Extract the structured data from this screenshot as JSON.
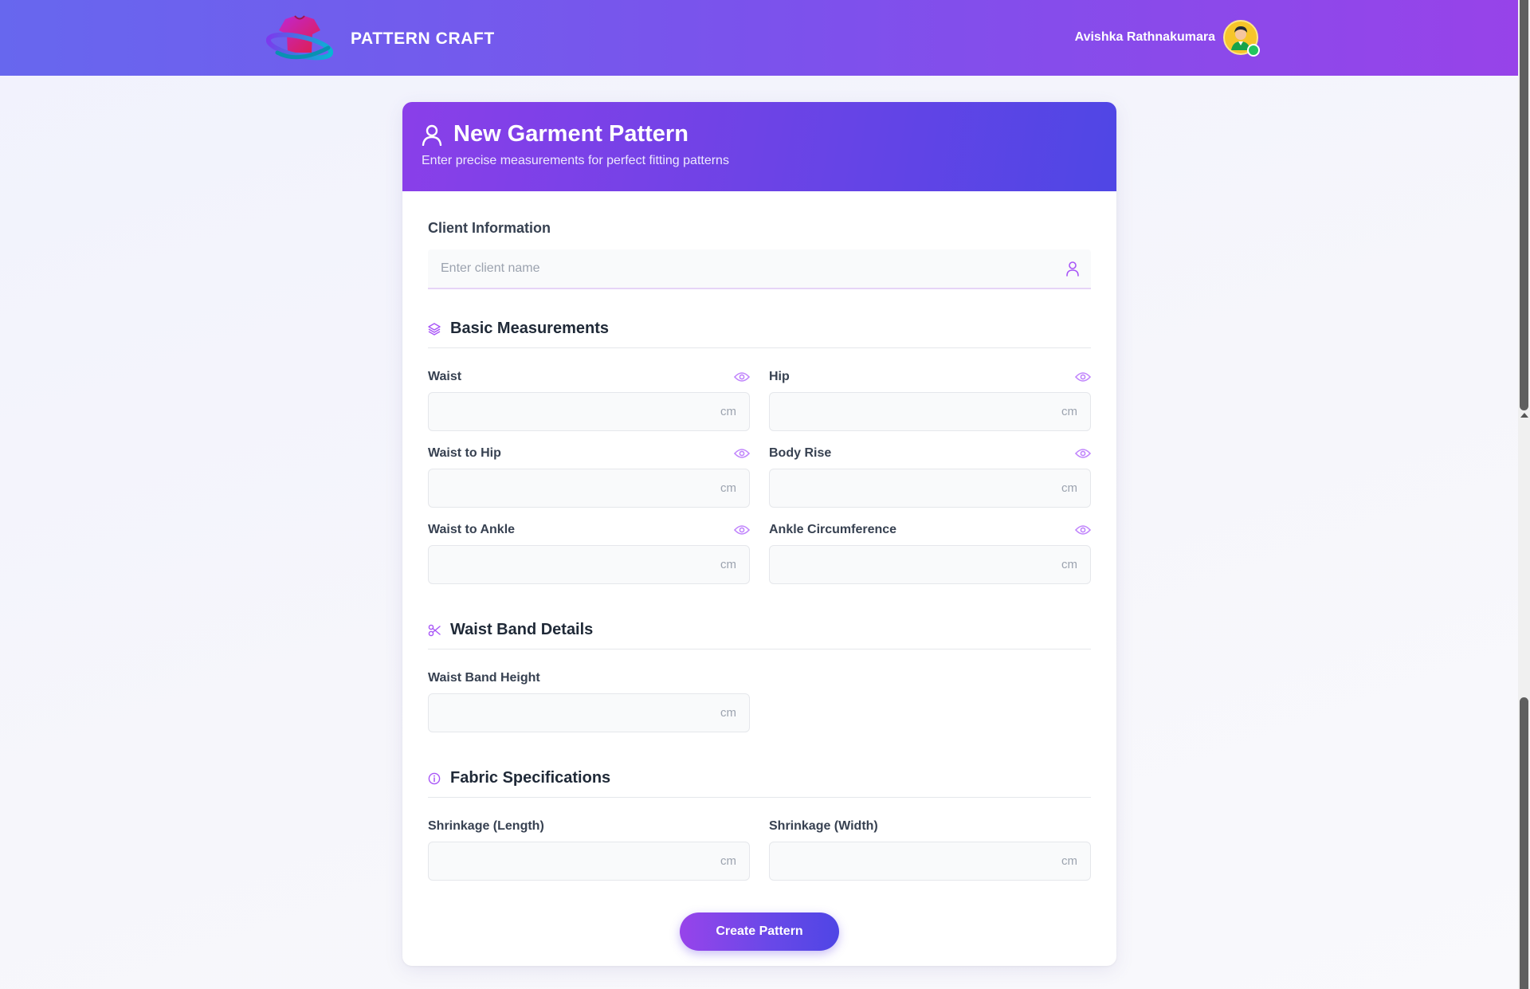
{
  "app": {
    "name": "PATTERN CRAFT"
  },
  "user": {
    "name": "Avishka Rathnakumara",
    "status": "online"
  },
  "colors": {
    "accent": "#8b5cf6",
    "header_start": "#6767ee",
    "header_end": "#9743e9",
    "online": "#22c55e"
  },
  "card": {
    "title": "New Garment Pattern",
    "subtitle": "Enter precise measurements for perfect fitting patterns"
  },
  "client": {
    "label": "Client Information",
    "placeholder": "Enter client name",
    "value": ""
  },
  "sections": {
    "basic": {
      "title": "Basic Measurements",
      "icon": "layers-icon",
      "fields": [
        {
          "label": "Waist",
          "unit": "cm",
          "value": ""
        },
        {
          "label": "Hip",
          "unit": "cm",
          "value": ""
        },
        {
          "label": "Waist to Hip",
          "unit": "cm",
          "value": ""
        },
        {
          "label": "Body Rise",
          "unit": "cm",
          "value": ""
        },
        {
          "label": "Waist to Ankle",
          "unit": "cm",
          "value": ""
        },
        {
          "label": "Ankle Circumference",
          "unit": "cm",
          "value": ""
        }
      ]
    },
    "waistband": {
      "title": "Waist Band Details",
      "icon": "scissors-icon",
      "fields": [
        {
          "label": "Waist Band Height",
          "unit": "cm",
          "value": ""
        }
      ]
    },
    "fabric": {
      "title": "Fabric Specifications",
      "icon": "info-icon",
      "fields": [
        {
          "label": "Shrinkage (Length)",
          "unit": "cm",
          "value": ""
        },
        {
          "label": "Shrinkage (Width)",
          "unit": "cm",
          "value": ""
        }
      ]
    }
  },
  "actions": {
    "create_label": "Create Pattern"
  }
}
